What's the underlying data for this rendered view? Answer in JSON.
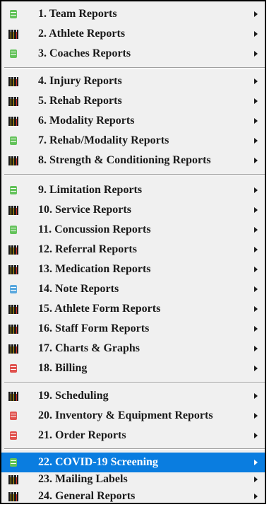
{
  "menu": {
    "items": [
      {
        "label": "1. Team Reports",
        "icon": "green-stack-icon"
      },
      {
        "label": "2. Athlete Reports",
        "icon": "people-icon"
      },
      {
        "label": "3. Coaches Reports",
        "icon": "green-stack-icon"
      },
      {
        "label": "4. Injury Reports",
        "icon": "people-icon"
      },
      {
        "label": "5. Rehab Reports",
        "icon": "people-icon"
      },
      {
        "label": "6. Modality Reports",
        "icon": "people-icon"
      },
      {
        "label": "7. Rehab/Modality Reports",
        "icon": "green-stack-icon"
      },
      {
        "label": "8. Strength & Conditioning Reports",
        "icon": "people-icon"
      },
      {
        "label": "9. Limitation Reports",
        "icon": "green-stack-icon"
      },
      {
        "label": "10. Service Reports",
        "icon": "people-icon"
      },
      {
        "label": "11. Concussion Reports",
        "icon": "green-stack-icon"
      },
      {
        "label": "12. Referral Reports",
        "icon": "people-icon"
      },
      {
        "label": "13. Medication Reports",
        "icon": "people-icon"
      },
      {
        "label": "14. Note Reports",
        "icon": "blue-stack-icon"
      },
      {
        "label": "15. Athlete Form Reports",
        "icon": "people-icon"
      },
      {
        "label": "16. Staff Form Reports",
        "icon": "people-icon"
      },
      {
        "label": "17. Charts & Graphs",
        "icon": "people-icon"
      },
      {
        "label": "18. Billing",
        "icon": "red-stack-icon"
      },
      {
        "label": "19. Scheduling",
        "icon": "people-icon"
      },
      {
        "label": "20. Inventory & Equipment Reports",
        "icon": "red-stack-icon"
      },
      {
        "label": "21. Order Reports",
        "icon": "red-stack-icon"
      },
      {
        "label": "22. COVID-19 Screening",
        "icon": "green-stack-icon",
        "selected": true
      },
      {
        "label": "23. Mailing Labels",
        "icon": "people-icon"
      },
      {
        "label": "24. General Reports",
        "icon": "people-icon"
      }
    ]
  },
  "colors": {
    "menu_bg": "#f0f0f0",
    "selection": "#0a7de0",
    "green": "#63c25a",
    "blue": "#5aa8de",
    "red": "#e0524e"
  }
}
